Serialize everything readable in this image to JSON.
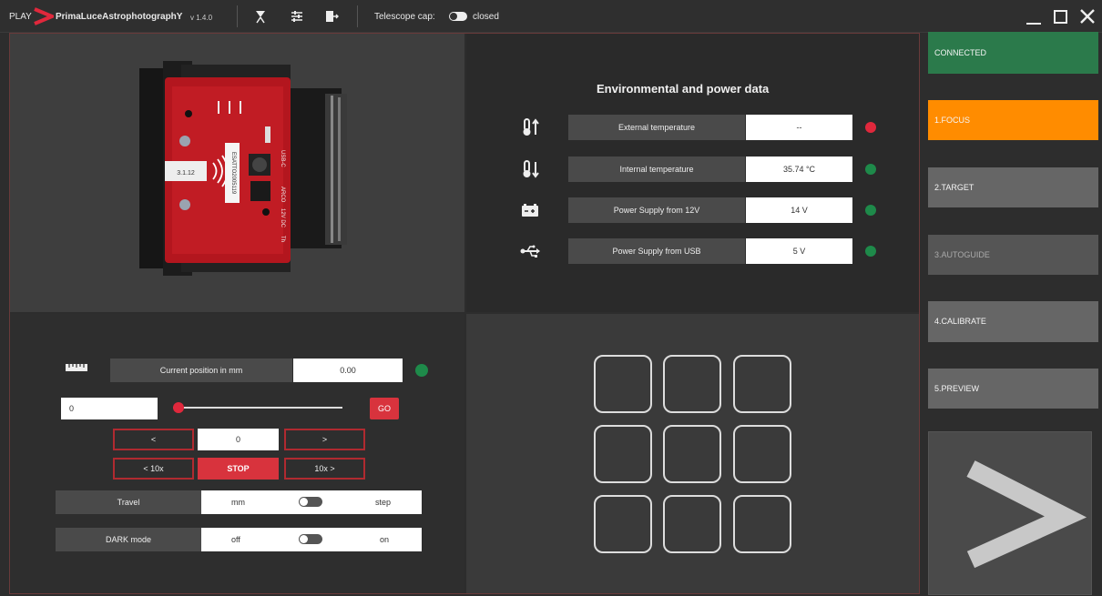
{
  "titlebar": {
    "play": "PLAY",
    "brand": "PrimaLuceAstrophotographY",
    "version": "v 1.4.0",
    "cap_label": "Telescope cap:",
    "cap_state": "closed",
    "icons": [
      "telescope-icon",
      "sliders-icon",
      "export-icon"
    ],
    "window_controls": [
      "minimize-icon",
      "maximize-icon",
      "close-icon"
    ]
  },
  "camera": {
    "labels": [
      "3.1.12",
      "ESATTO2005119",
      "USB-C",
      "ARCO",
      "12V DC",
      "Th"
    ]
  },
  "env": {
    "title": "Environmental and power data",
    "rows": [
      {
        "icon": "temperature-up-icon",
        "label": "External temperature",
        "value": "--",
        "status_color": "#e0283c"
      },
      {
        "icon": "temperature-down-icon",
        "label": "Internal temperature",
        "value": "35.74 °C",
        "status_color": "#1e8a4a"
      },
      {
        "icon": "battery-icon",
        "label": "Power Supply from 12V",
        "value": "14 V",
        "status_color": "#1e8a4a"
      },
      {
        "icon": "usb-icon",
        "label": "Power Supply from USB",
        "value": "5 V",
        "status_color": "#1e8a4a"
      }
    ]
  },
  "control": {
    "position_label": "Current position in mm",
    "position_value": "0.00",
    "position_status_color": "#1e8a4a",
    "target_input": "0",
    "slider_level": 0,
    "go": "GO",
    "step_left": "<",
    "step_value": "0",
    "step_right": ">",
    "step_left10": "< 10x",
    "stop": "STOP",
    "step_right10": "10x >",
    "travel_label": "Travel",
    "travel_left": "mm",
    "travel_right": "step",
    "dark_label": "DARK mode",
    "dark_left": "off",
    "dark_right": "on"
  },
  "steps": {
    "connected": "CONNECTED",
    "focus": "1.FOCUS",
    "target": "2.TARGET",
    "autoguide": "3.AUTOGUIDE",
    "calibrate": "4.CALIBRATE",
    "preview": "5.PREVIEW"
  },
  "colors": {
    "accent_red": "#d8333d",
    "connected_green": "#2b7a4b",
    "focus_orange": "#ff8c00"
  }
}
